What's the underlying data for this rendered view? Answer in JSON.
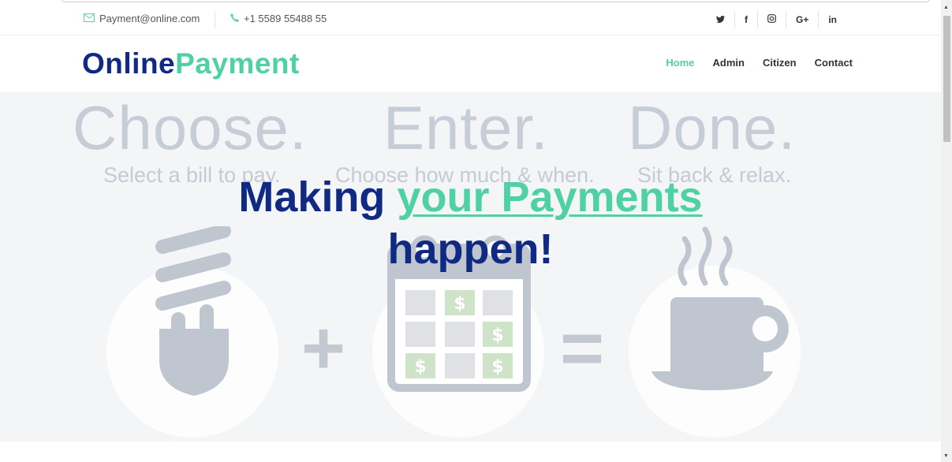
{
  "topbar": {
    "email": "Payment@online.com",
    "phone": "+1 5589 55488 55",
    "social": [
      "twitter",
      "facebook",
      "instagram",
      "google-plus",
      "linkedin"
    ],
    "social_glyphs": [
      "🐦",
      "f",
      "◎",
      "G+",
      "in"
    ]
  },
  "header": {
    "logo_part1": "Online",
    "logo_part2": "Payment",
    "nav": [
      "Home",
      "Admin",
      "Citizen",
      "Contact"
    ],
    "active_nav": "Home"
  },
  "hero": {
    "steps": [
      "Choose.",
      "Enter.",
      "Done."
    ],
    "captions": [
      "Select a bill to pay.",
      "Choose how much & when.",
      "Sit back & relax."
    ],
    "plus": "+",
    "equals": "=",
    "headline_part1": "Making",
    "headline_highlight": "your Payments",
    "headline_part2": "happen!"
  },
  "colors": {
    "brand_dark": "#102a83",
    "brand_accent": "#4fd1a3"
  }
}
